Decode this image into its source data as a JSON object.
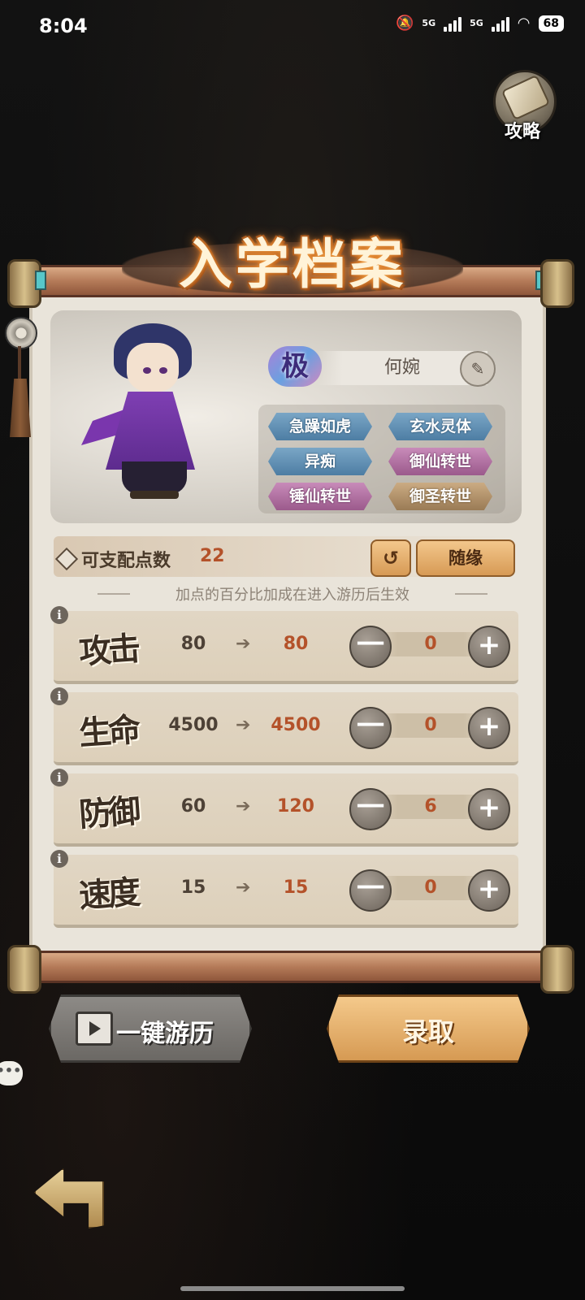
{
  "status_bar": {
    "time": "8:04",
    "net1": "5G",
    "net2": "5G",
    "battery": "68"
  },
  "guide": {
    "label": "攻略"
  },
  "panel": {
    "title": "入学档案",
    "character": {
      "rank": "极",
      "name": "何婉",
      "traits": [
        {
          "label": "急躁如虎",
          "color": "blue"
        },
        {
          "label": "玄水灵体",
          "color": "blue"
        },
        {
          "label": "异痴",
          "color": "blue"
        },
        {
          "label": "御仙转世",
          "color": "pink"
        },
        {
          "label": "锤仙转世",
          "color": "pink"
        },
        {
          "label": "御圣转世",
          "color": "gold"
        }
      ]
    },
    "points": {
      "label": "可支配点数",
      "value": "22",
      "reset_icon": "undo-icon",
      "random_label": "随缘"
    },
    "hint": "加点的百分比加成在进入游历后生效",
    "stats": [
      {
        "name": "攻击",
        "base": "80",
        "result": "80",
        "allocated": "0"
      },
      {
        "name": "生命",
        "base": "4500",
        "result": "4500",
        "allocated": "0"
      },
      {
        "name": "防御",
        "base": "60",
        "result": "120",
        "allocated": "6"
      },
      {
        "name": "速度",
        "base": "15",
        "result": "15",
        "allocated": "0"
      }
    ],
    "stat_symbols": {
      "info": "i",
      "minus": "一",
      "plus": "+",
      "arrow": "➔"
    }
  },
  "actions": {
    "auto_travel": "一键游历",
    "enroll": "录取"
  },
  "colors": {
    "accent": "#b4522a",
    "button_gold": "#d79a55",
    "button_gray": "#6b6864"
  }
}
